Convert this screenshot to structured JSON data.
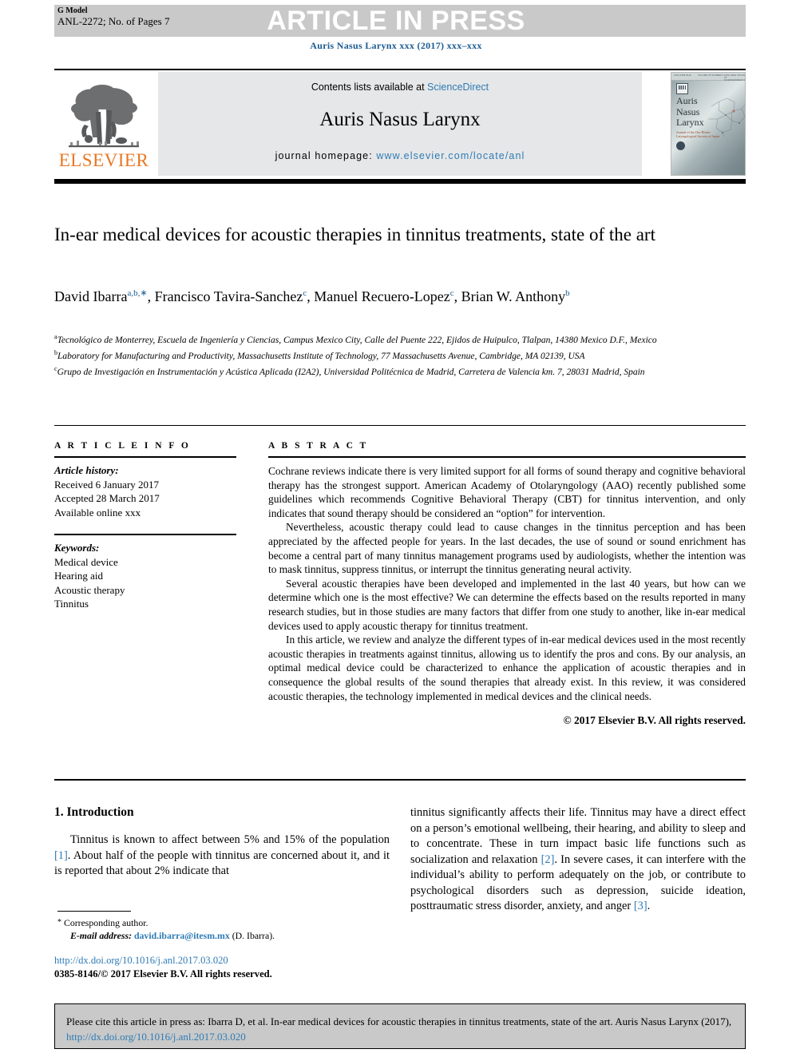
{
  "header": {
    "g_model_label": "G Model",
    "g_model_id": "ANL-2272; No. of Pages 7",
    "stamp": "ARTICLE IN PRESS",
    "journal_ref": "Auris Nasus Larynx xxx (2017) xxx–xxx"
  },
  "masthead": {
    "publisher": "ELSEVIER",
    "contents_prefix": "Contents lists available at ",
    "contents_link": "ScienceDirect",
    "journal_title": "Auris Nasus Larynx",
    "homepage_prefix": "journal homepage: ",
    "homepage_link": "www.elsevier.com/locate/anl",
    "cover": {
      "title_line1": "Auris",
      "title_line2": "Nasus",
      "title_line3": "Larynx",
      "subtitle": "Journal of the Oto-Rhino-Laryngological Society of Japan",
      "topbar_left": "ISSN 0385-8146",
      "topbar_mid": "VOLUME 00 NUMBER 0",
      "topbar_right": "AVAILABLE ONLINE AT SCIENCEDIRECT.COM"
    }
  },
  "article": {
    "title": "In-ear medical devices for acoustic therapies in tinnitus treatments, state of the art",
    "authors": [
      {
        "name": "David Ibarra",
        "sup": "a,b,∗",
        "sep": ", "
      },
      {
        "name": "Francisco Tavira-Sanchez",
        "sup": "c",
        "sep": ", "
      },
      {
        "name": "Manuel Recuero-Lopez",
        "sup": "c",
        "sep": ", "
      },
      {
        "name": "Brian W. Anthony",
        "sup": "b",
        "sep": ""
      }
    ],
    "affiliations": [
      {
        "mark": "a",
        "text": "Tecnológico de Monterrey, Escuela de Ingeniería y Ciencias, Campus Mexico City, Calle del Puente 222, Ejidos de Huipulco, Tlalpan, 14380 Mexico D.F., Mexico"
      },
      {
        "mark": "b",
        "text": "Laboratory for Manufacturing and Productivity, Massachusetts Institute of Technology, 77 Massachusetts Avenue, Cambridge, MA 02139, USA"
      },
      {
        "mark": "c",
        "text": "Grupo de Investigación en Instrumentación y Acústica Aplicada (I2A2), Universidad Politécnica de Madrid, Carretera de Valencia km. 7, 28031 Madrid, Spain"
      }
    ]
  },
  "article_info": {
    "heading": "A R T I C L E   I N F O",
    "history_label": "Article history:",
    "history": [
      "Received 6 January 2017",
      "Accepted 28 March 2017",
      "Available online xxx"
    ],
    "keywords_label": "Keywords:",
    "keywords": [
      "Medical device",
      "Hearing aid",
      "Acoustic therapy",
      "Tinnitus"
    ]
  },
  "abstract": {
    "heading": "A B S T R A C T",
    "paragraphs": [
      "Cochrane reviews indicate there is very limited support for all forms of sound therapy and cognitive behavioral therapy has the strongest support. American Academy of Otolaryngology (AAO) recently published some guidelines which recommends Cognitive Behavioral Therapy (CBT) for tinnitus intervention, and only indicates that sound therapy should be considered an “option” for intervention.",
      "Nevertheless, acoustic therapy could lead to cause changes in the tinnitus perception and has been appreciated by the affected people for years. In the last decades, the use of sound or sound enrichment has become a central part of many tinnitus management programs used by audiologists, whether the intention was to mask tinnitus, suppress tinnitus, or interrupt the tinnitus generating neural activity.",
      "Several acoustic therapies have been developed and implemented in the last 40 years, but how can we determine which one is the most effective? We can determine the effects based on the results reported in many research studies, but in those studies are many factors that differ from one study to another, like in-ear medical devices used to apply acoustic therapy for tinnitus treatment.",
      "In this article, we review and analyze the different types of in-ear medical devices used in the most recently acoustic therapies in treatments against tinnitus, allowing us to identify the pros and cons. By our analysis, an optimal medical device could be characterized to enhance the application of acoustic therapies and in consequence the global results of the sound therapies that already exist. In this review, it was considered acoustic therapies, the technology implemented in medical devices and the clinical needs."
    ],
    "copyright": "© 2017 Elsevier B.V. All rights reserved."
  },
  "introduction": {
    "heading": "1. Introduction",
    "left_paragraph_a": "Tinnitus is known to affect between 5% and 15% of the population ",
    "left_ref_1": "[1]",
    "left_paragraph_b": ". About half of the people with tinnitus are concerned about it, and it is reported that about 2% indicate that",
    "right_paragraph_a": "tinnitus significantly affects their life. Tinnitus may have a direct effect on a person’s emotional wellbeing, their hearing, and ability to sleep and to concentrate. These in turn impact basic life functions such as socialization and relaxation ",
    "right_ref_2": "[2]",
    "right_paragraph_b": ". In severe cases, it can interfere with the individual’s ability to perform adequately on the job, or contribute to psychological disorders such as depression, suicide ideation, posttraumatic stress disorder, anxiety, and anger ",
    "right_ref_3": "[3]",
    "right_paragraph_c": "."
  },
  "footnote": {
    "star": "*",
    "corresponding": " Corresponding author.",
    "email_label": "E-mail address:",
    "email": "david.ibarra@itesm.mx",
    "email_owner": "(D. Ibarra)."
  },
  "doi_block": {
    "doi_url": "http://dx.doi.org/10.1016/j.anl.2017.03.020",
    "issn_line": "0385-8146/© 2017 Elsevier B.V. All rights reserved."
  },
  "citation_box": {
    "text_a": "Please cite this article in press as: Ibarra D, et al. In-ear medical devices for acoustic therapies in tinnitus treatments, state of the art. Auris Nasus Larynx  (2017), ",
    "link": "http://dx.doi.org/10.1016/j.anl.2017.03.020"
  },
  "colors": {
    "link_blue": "#2e7bb5",
    "ref_blue": "#1a5b92",
    "elsevier_orange": "#e87722",
    "band_gray": "#c9c9c9",
    "panel_gray": "#e6e7e8"
  }
}
